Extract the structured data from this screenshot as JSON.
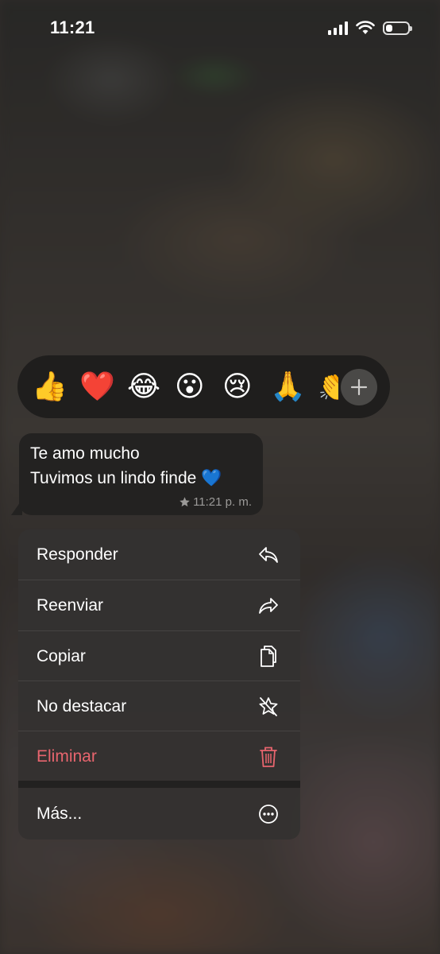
{
  "status_bar": {
    "time": "11:21",
    "signal_icon": "signal-bars-icon",
    "wifi_icon": "wifi-icon",
    "battery_icon": "battery-icon",
    "battery_level": 0.3
  },
  "reactions": {
    "emojis": [
      "👍",
      "❤️",
      "😂",
      "😮",
      "😢",
      "🙏",
      "👏"
    ],
    "add_icon": "plus-icon"
  },
  "message": {
    "line1": "Te amo mucho",
    "line2": "Tuvimos un lindo finde 💙",
    "star_icon": "star-icon",
    "time": "11:21 p. m."
  },
  "menu": {
    "reply": "Responder",
    "forward": "Reenviar",
    "copy": "Copiar",
    "unstar": "No destacar",
    "delete": "Eliminar",
    "more": "Más..."
  },
  "colors": {
    "danger": "#e8656e",
    "menu_bg": "#343231",
    "bubble_bg": "#232221"
  }
}
